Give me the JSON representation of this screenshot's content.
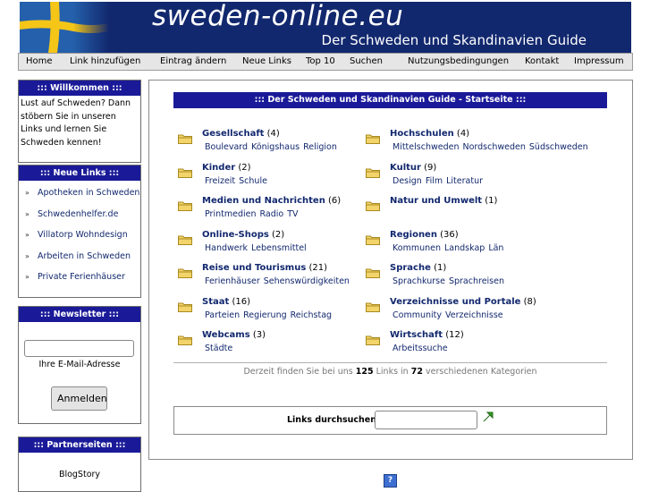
{
  "header": {
    "site_title": "sweden-online.eu",
    "subtitle": "Der Schweden und Skandinavien Guide",
    "flag_colors": {
      "blue": "#1f5aa6",
      "yellow": "#f5c518"
    }
  },
  "nav": {
    "items": [
      {
        "label": "Home"
      },
      {
        "label": "Link hinzufügen"
      },
      {
        "label": "Eintrag ändern"
      },
      {
        "label": "Neue Links"
      },
      {
        "label": "Top 10"
      },
      {
        "label": "Suchen"
      },
      {
        "label": "Nutzungsbedingungen"
      },
      {
        "label": "Kontakt"
      },
      {
        "label": "Impressum"
      }
    ]
  },
  "sidebar": {
    "welcome": {
      "title": "::: Willkommen :::",
      "text": "Lust auf Schweden? Dann stöbern Sie in unseren Links und lernen Sie Schweden kennen!"
    },
    "new_links": {
      "title": "::: Neue Links :::",
      "bullet": "»",
      "items": [
        "Apotheken in Schweden",
        "Schwedenhelfer.de",
        "Villatorp Wohndesign",
        "Arbeiten in Schweden",
        "Private Ferienhäuser"
      ]
    },
    "newsletter": {
      "title": "::: Newsletter :::",
      "input_value": "",
      "label": "Ihre E-Mail-Adresse",
      "button": "Anmelden"
    },
    "partners": {
      "title": "::: Partnerseiten :::",
      "items": [
        "BlogStory"
      ]
    }
  },
  "main": {
    "heading": "::: Der Schweden und Skandinavien Guide - Startseite :::",
    "categories": [
      {
        "name": "Gesellschaft",
        "count": "(4)",
        "subs": [
          "Boulevard",
          "Königshaus",
          "Religion"
        ]
      },
      {
        "name": "Hochschulen",
        "count": "(4)",
        "subs": [
          "Mittelschweden",
          "Nordschweden",
          "Südschweden"
        ]
      },
      {
        "name": "Kinder",
        "count": "(2)",
        "subs": [
          "Freizeit",
          "Schule"
        ]
      },
      {
        "name": "Kultur",
        "count": "(9)",
        "subs": [
          "Design",
          "Film",
          "Literatur"
        ]
      },
      {
        "name": "Medien und Nachrichten",
        "count": "(6)",
        "subs": [
          "Printmedien",
          "Radio",
          "TV"
        ]
      },
      {
        "name": "Natur und Umwelt",
        "count": "(1)",
        "subs": []
      },
      {
        "name": "Online-Shops",
        "count": "(2)",
        "subs": [
          "Handwerk",
          "Lebensmittel"
        ]
      },
      {
        "name": "Regionen",
        "count": "(36)",
        "subs": [
          "Kommunen",
          "Landskap",
          "Län"
        ]
      },
      {
        "name": "Reise und Tourismus",
        "count": "(21)",
        "subs": [
          "Ferienhäuser",
          "Sehenswürdigkeiten"
        ]
      },
      {
        "name": "Sprache",
        "count": "(1)",
        "subs": [
          "Sprachkurse",
          "Sprachreisen"
        ]
      },
      {
        "name": "Staat",
        "count": "(16)",
        "subs": [
          "Parteien",
          "Regierung",
          "Reichstag"
        ]
      },
      {
        "name": "Verzeichnisse und Portale",
        "count": "(8)",
        "subs": [
          "Community",
          "Verzeichnisse"
        ]
      },
      {
        "name": "Webcams",
        "count": "(3)",
        "subs": [
          "Städte"
        ]
      },
      {
        "name": "Wirtschaft",
        "count": "(12)",
        "subs": [
          "Arbeitssuche"
        ]
      }
    ],
    "stats": {
      "prefix": "Derzeit finden Sie bei uns",
      "links": "125",
      "middle": "Links in",
      "categories": "72",
      "suffix": "verschiedenen Kategorien"
    },
    "search": {
      "label": "Links durchsuchen",
      "input_value": ""
    },
    "help_icon_label": "?"
  }
}
